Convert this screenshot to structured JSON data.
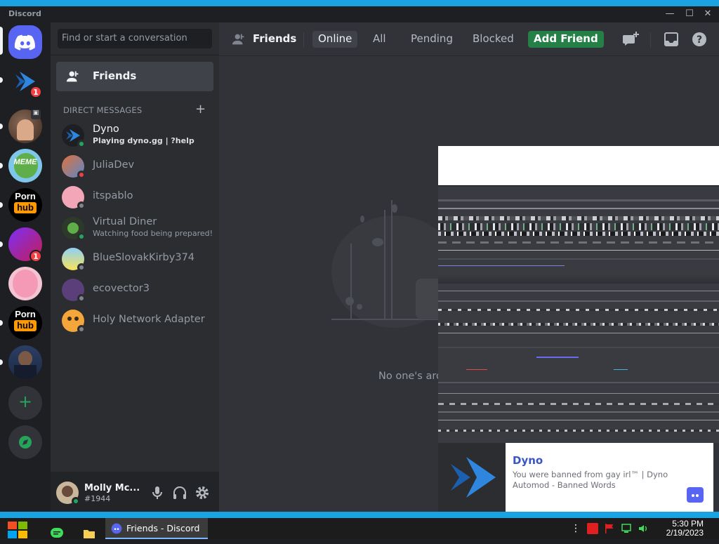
{
  "window": {
    "app_title": "Discord",
    "min": "—",
    "max": "☐",
    "close": "✕"
  },
  "servers": {
    "badges": [
      "1",
      "1"
    ],
    "text_server_1": [
      "Porn",
      "hub"
    ],
    "text_server_2": [
      "Porn",
      "hub"
    ],
    "meme_label": "MEME"
  },
  "sidebar": {
    "search_placeholder": "Find or start a conversation",
    "friends_label": "Friends",
    "dm_header": "DIRECT MESSAGES",
    "dms": [
      {
        "name": "Dyno",
        "sub": "Playing dyno.gg | ?help",
        "status": "online"
      },
      {
        "name": "JuliaDev",
        "sub": "",
        "status": "dnd"
      },
      {
        "name": "itspablo",
        "sub": "",
        "status": "offline"
      },
      {
        "name": "Virtual Diner",
        "sub": "Watching food being prepared!",
        "status": "online"
      },
      {
        "name": "BlueSlovakKirby374",
        "sub": "",
        "status": "offline"
      },
      {
        "name": "ecovector3",
        "sub": "",
        "status": "offline"
      },
      {
        "name": "Holy Network Adapter",
        "sub": "",
        "status": "offline"
      }
    ]
  },
  "user": {
    "name": "Molly Mc...",
    "tag": "#1944"
  },
  "topbar": {
    "title": "Friends",
    "tabs": [
      "Online",
      "All",
      "Pending",
      "Blocked"
    ],
    "add_friend": "Add Friend"
  },
  "main": {
    "empty_text": "No one's aro"
  },
  "toast": {
    "title": "Dyno",
    "body": "You were banned from gay irl™ | Dyno Automod - Banned Words"
  },
  "taskbar": {
    "active_task": "Friends - Discord",
    "time": "5:30 PM",
    "date": "2/19/2023"
  },
  "colors": {
    "blurple": "#5865f2",
    "green": "#23a55a",
    "red": "#f23f43",
    "add_friend": "#248046",
    "accent_stripe": "#1aa3e0"
  }
}
